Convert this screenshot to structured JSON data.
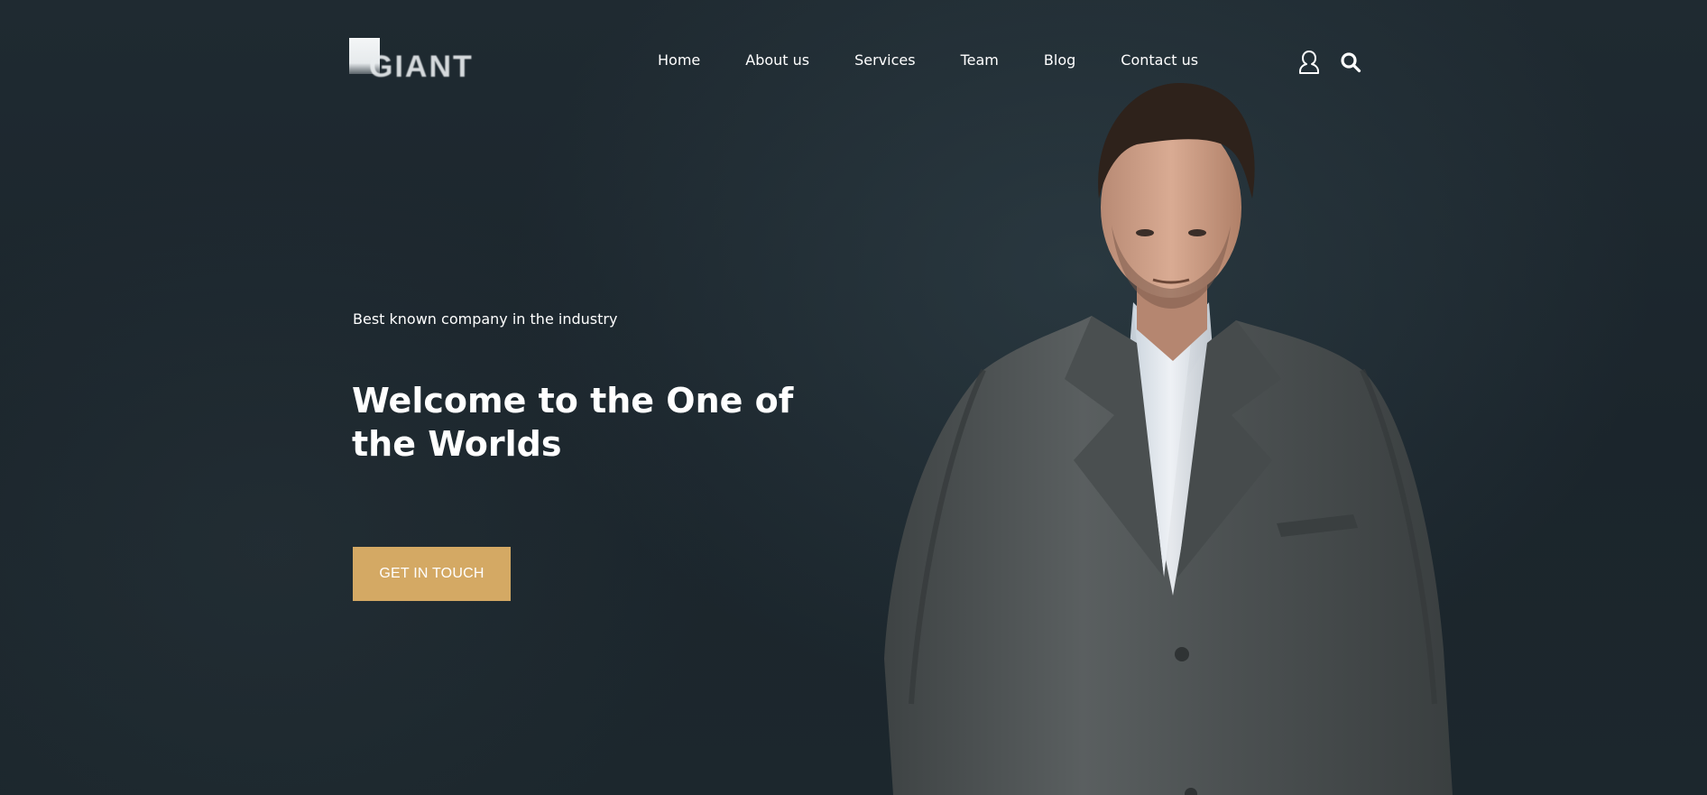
{
  "brand": {
    "logo_text": "GIANT"
  },
  "nav": {
    "items": [
      {
        "label": "Home"
      },
      {
        "label": "About us"
      },
      {
        "label": "Services"
      },
      {
        "label": "Team"
      },
      {
        "label": "Blog"
      },
      {
        "label": "Contact us"
      }
    ]
  },
  "header_icons": {
    "user": "user-icon",
    "search": "search-icon"
  },
  "hero": {
    "tagline": "Best known company in the industry",
    "headline": "Welcome to the One of the Worlds",
    "cta_label": "GET IN TOUCH",
    "image": "man-in-suit-photo"
  },
  "colors": {
    "background": "#1b252c",
    "accent": "#d4a964",
    "text": "#ffffff"
  }
}
